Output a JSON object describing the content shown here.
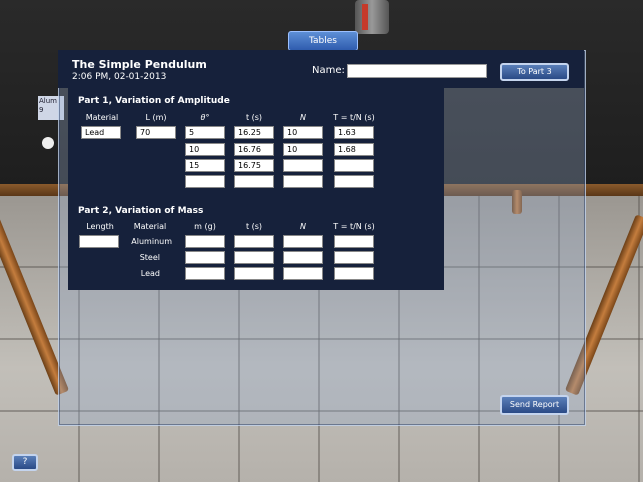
{
  "window": {
    "tables_tab": "Tables",
    "title": "The Simple Pendulum",
    "timestamp": "2:06 PM, 02-01-2013",
    "name_label": "Name:",
    "name_value": "",
    "to_part3": "To Part 3",
    "send_report": "Send Report",
    "help": "?"
  },
  "background": {
    "side_label": "Alum 9"
  },
  "part1": {
    "heading": "Part 1, Variation of Amplitude",
    "columns": [
      "Material",
      "L (m)",
      "θ°",
      "t (s)",
      "N",
      "T = t/N (s)"
    ],
    "material": "Lead",
    "length": "70",
    "rows": [
      {
        "theta": "5",
        "t": "16.25",
        "n": "10",
        "T": "1.63"
      },
      {
        "theta": "10",
        "t": "16.76",
        "n": "10",
        "T": "1.68"
      },
      {
        "theta": "15",
        "t": "16.75",
        "n": "",
        "T": ""
      },
      {
        "theta": "",
        "t": "",
        "n": "",
        "T": ""
      }
    ]
  },
  "part2": {
    "heading": "Part 2, Variation of Mass",
    "columns": [
      "Length",
      "Material",
      "m (g)",
      "t (s)",
      "N",
      "T = t/N (s)"
    ],
    "length": "",
    "rows": [
      {
        "material": "Aluminum",
        "m": "",
        "t": "",
        "n": "",
        "T": ""
      },
      {
        "material": "Steel",
        "m": "",
        "t": "",
        "n": "",
        "T": ""
      },
      {
        "material": "Lead",
        "m": "",
        "t": "",
        "n": "",
        "T": ""
      }
    ]
  }
}
